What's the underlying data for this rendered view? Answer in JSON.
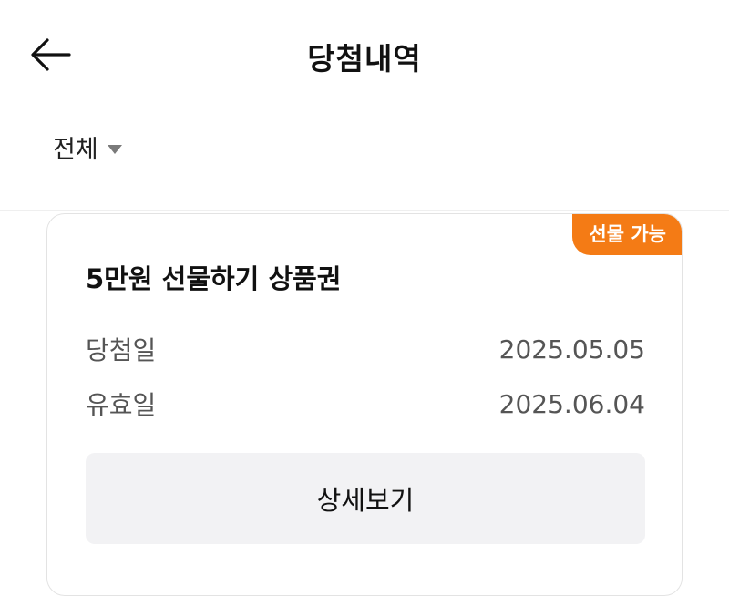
{
  "header": {
    "title": "당첨내역",
    "back_icon": "arrow-left-icon"
  },
  "filter": {
    "label": "전체",
    "caret_icon": "caret-down-icon"
  },
  "card": {
    "badge": "선물 가능",
    "badge_color": "#f47b15",
    "product_name": "5만원 선물하기 상품권",
    "win_date_label": "당첨일",
    "win_date": "2025.05.05",
    "expiry_label": "유효일",
    "expiry_date": "2025.06.04",
    "detail_button": "상세보기"
  }
}
